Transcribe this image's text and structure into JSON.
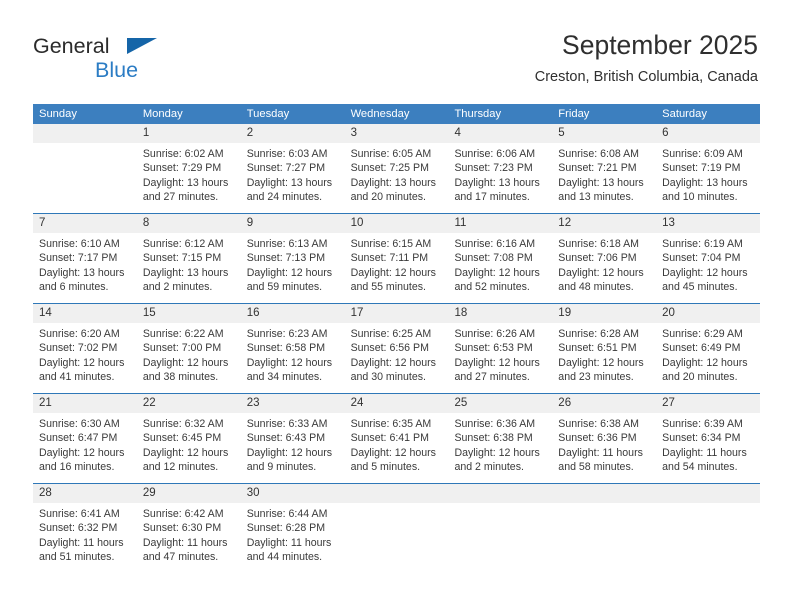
{
  "brand": {
    "name_top": "General",
    "name_bottom": "Blue",
    "triangle_color": "#1565a8",
    "text_color_top": "#2b2b2b",
    "text_color_bottom": "#2b7cc4"
  },
  "header": {
    "title": "September 2025",
    "subtitle": "Creston, British Columbia, Canada"
  },
  "theme": {
    "header_bar": "#3c7fbf",
    "row_divider": "#2f78b8",
    "date_band": "#f0f0f0",
    "body": "#ffffff",
    "text": "#3a3a3a"
  },
  "weekdays": [
    "Sunday",
    "Monday",
    "Tuesday",
    "Wednesday",
    "Thursday",
    "Friday",
    "Saturday"
  ],
  "weeks": [
    [
      {
        "day": "",
        "lines": []
      },
      {
        "day": "1",
        "lines": [
          "Sunrise: 6:02 AM",
          "Sunset: 7:29 PM",
          "Daylight: 13 hours and 27 minutes."
        ]
      },
      {
        "day": "2",
        "lines": [
          "Sunrise: 6:03 AM",
          "Sunset: 7:27 PM",
          "Daylight: 13 hours and 24 minutes."
        ]
      },
      {
        "day": "3",
        "lines": [
          "Sunrise: 6:05 AM",
          "Sunset: 7:25 PM",
          "Daylight: 13 hours and 20 minutes."
        ]
      },
      {
        "day": "4",
        "lines": [
          "Sunrise: 6:06 AM",
          "Sunset: 7:23 PM",
          "Daylight: 13 hours and 17 minutes."
        ]
      },
      {
        "day": "5",
        "lines": [
          "Sunrise: 6:08 AM",
          "Sunset: 7:21 PM",
          "Daylight: 13 hours and 13 minutes."
        ]
      },
      {
        "day": "6",
        "lines": [
          "Sunrise: 6:09 AM",
          "Sunset: 7:19 PM",
          "Daylight: 13 hours and 10 minutes."
        ]
      }
    ],
    [
      {
        "day": "7",
        "lines": [
          "Sunrise: 6:10 AM",
          "Sunset: 7:17 PM",
          "Daylight: 13 hours and 6 minutes."
        ]
      },
      {
        "day": "8",
        "lines": [
          "Sunrise: 6:12 AM",
          "Sunset: 7:15 PM",
          "Daylight: 13 hours and 2 minutes."
        ]
      },
      {
        "day": "9",
        "lines": [
          "Sunrise: 6:13 AM",
          "Sunset: 7:13 PM",
          "Daylight: 12 hours and 59 minutes."
        ]
      },
      {
        "day": "10",
        "lines": [
          "Sunrise: 6:15 AM",
          "Sunset: 7:11 PM",
          "Daylight: 12 hours and 55 minutes."
        ]
      },
      {
        "day": "11",
        "lines": [
          "Sunrise: 6:16 AM",
          "Sunset: 7:08 PM",
          "Daylight: 12 hours and 52 minutes."
        ]
      },
      {
        "day": "12",
        "lines": [
          "Sunrise: 6:18 AM",
          "Sunset: 7:06 PM",
          "Daylight: 12 hours and 48 minutes."
        ]
      },
      {
        "day": "13",
        "lines": [
          "Sunrise: 6:19 AM",
          "Sunset: 7:04 PM",
          "Daylight: 12 hours and 45 minutes."
        ]
      }
    ],
    [
      {
        "day": "14",
        "lines": [
          "Sunrise: 6:20 AM",
          "Sunset: 7:02 PM",
          "Daylight: 12 hours and 41 minutes."
        ]
      },
      {
        "day": "15",
        "lines": [
          "Sunrise: 6:22 AM",
          "Sunset: 7:00 PM",
          "Daylight: 12 hours and 38 minutes."
        ]
      },
      {
        "day": "16",
        "lines": [
          "Sunrise: 6:23 AM",
          "Sunset: 6:58 PM",
          "Daylight: 12 hours and 34 minutes."
        ]
      },
      {
        "day": "17",
        "lines": [
          "Sunrise: 6:25 AM",
          "Sunset: 6:56 PM",
          "Daylight: 12 hours and 30 minutes."
        ]
      },
      {
        "day": "18",
        "lines": [
          "Sunrise: 6:26 AM",
          "Sunset: 6:53 PM",
          "Daylight: 12 hours and 27 minutes."
        ]
      },
      {
        "day": "19",
        "lines": [
          "Sunrise: 6:28 AM",
          "Sunset: 6:51 PM",
          "Daylight: 12 hours and 23 minutes."
        ]
      },
      {
        "day": "20",
        "lines": [
          "Sunrise: 6:29 AM",
          "Sunset: 6:49 PM",
          "Daylight: 12 hours and 20 minutes."
        ]
      }
    ],
    [
      {
        "day": "21",
        "lines": [
          "Sunrise: 6:30 AM",
          "Sunset: 6:47 PM",
          "Daylight: 12 hours and 16 minutes."
        ]
      },
      {
        "day": "22",
        "lines": [
          "Sunrise: 6:32 AM",
          "Sunset: 6:45 PM",
          "Daylight: 12 hours and 12 minutes."
        ]
      },
      {
        "day": "23",
        "lines": [
          "Sunrise: 6:33 AM",
          "Sunset: 6:43 PM",
          "Daylight: 12 hours and 9 minutes."
        ]
      },
      {
        "day": "24",
        "lines": [
          "Sunrise: 6:35 AM",
          "Sunset: 6:41 PM",
          "Daylight: 12 hours and 5 minutes."
        ]
      },
      {
        "day": "25",
        "lines": [
          "Sunrise: 6:36 AM",
          "Sunset: 6:38 PM",
          "Daylight: 12 hours and 2 minutes."
        ]
      },
      {
        "day": "26",
        "lines": [
          "Sunrise: 6:38 AM",
          "Sunset: 6:36 PM",
          "Daylight: 11 hours and 58 minutes."
        ]
      },
      {
        "day": "27",
        "lines": [
          "Sunrise: 6:39 AM",
          "Sunset: 6:34 PM",
          "Daylight: 11 hours and 54 minutes."
        ]
      }
    ],
    [
      {
        "day": "28",
        "lines": [
          "Sunrise: 6:41 AM",
          "Sunset: 6:32 PM",
          "Daylight: 11 hours and 51 minutes."
        ]
      },
      {
        "day": "29",
        "lines": [
          "Sunrise: 6:42 AM",
          "Sunset: 6:30 PM",
          "Daylight: 11 hours and 47 minutes."
        ]
      },
      {
        "day": "30",
        "lines": [
          "Sunrise: 6:44 AM",
          "Sunset: 6:28 PM",
          "Daylight: 11 hours and 44 minutes."
        ]
      },
      {
        "day": "",
        "lines": []
      },
      {
        "day": "",
        "lines": []
      },
      {
        "day": "",
        "lines": []
      },
      {
        "day": "",
        "lines": []
      }
    ]
  ]
}
